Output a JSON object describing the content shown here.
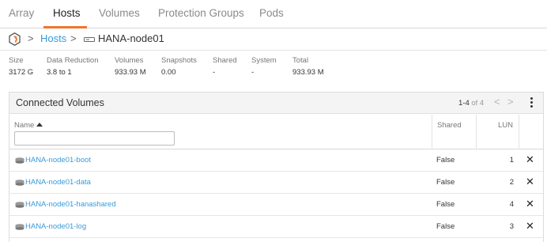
{
  "tabs": [
    {
      "label": "Array"
    },
    {
      "label": "Hosts"
    },
    {
      "label": "Volumes"
    },
    {
      "label": "Protection Groups"
    },
    {
      "label": "Pods"
    }
  ],
  "active_tab": "Hosts",
  "accent_color": "#f37430",
  "link_color": "#3a9ad9",
  "breadcrumb": {
    "separator": ">",
    "link": "Hosts",
    "current": "HANA-node01"
  },
  "stats": [
    {
      "label": "Size",
      "value": "3172 G"
    },
    {
      "label": "Data Reduction",
      "value": "3.8 to 1"
    },
    {
      "label": "Volumes",
      "value": "933.93 M"
    },
    {
      "label": "Snapshots",
      "value": "0.00"
    },
    {
      "label": "Shared",
      "value": "-"
    },
    {
      "label": "System",
      "value": "-"
    },
    {
      "label": "Total",
      "value": "933.93 M"
    }
  ],
  "panel": {
    "title": "Connected Volumes",
    "pager_range": "1-4",
    "pager_of": "of 4",
    "prev_icon": "<",
    "next_icon": ">"
  },
  "table": {
    "headers": {
      "name": "Name",
      "shared": "Shared",
      "lun": "LUN"
    },
    "filter_value": "",
    "rows": [
      {
        "name": "HANA-node01-boot",
        "shared": "False",
        "lun": "1",
        "action": "✕"
      },
      {
        "name": "HANA-node01-data",
        "shared": "False",
        "lun": "2",
        "action": "✕"
      },
      {
        "name": "HANA-node01-hanashared",
        "shared": "False",
        "lun": "4",
        "action": "✕"
      },
      {
        "name": "HANA-node01-log",
        "shared": "False",
        "lun": "3",
        "action": "✕"
      }
    ]
  }
}
